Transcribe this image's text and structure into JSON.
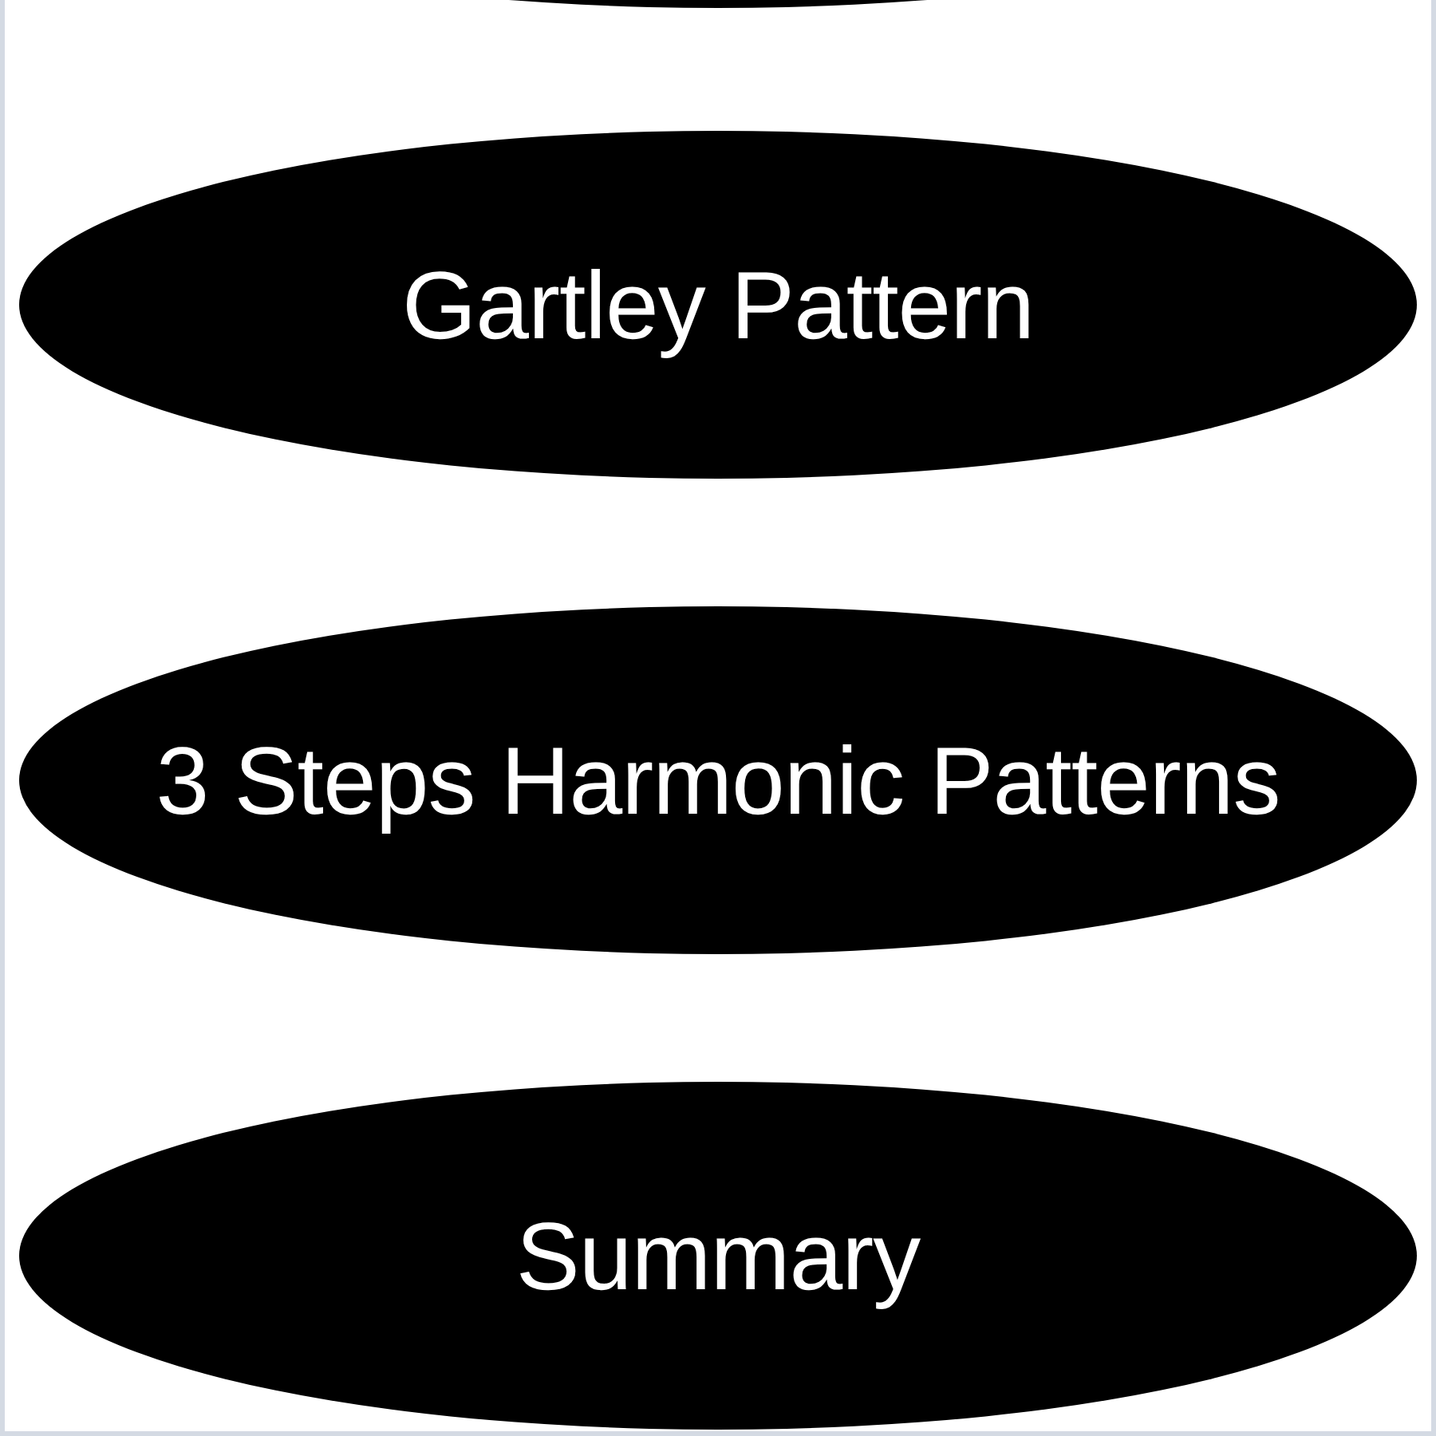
{
  "menu": {
    "buttons": [
      {
        "kind": "partial"
      },
      {
        "kind": "full",
        "label": "Gartley Pattern"
      },
      {
        "kind": "full",
        "label": "3 Steps Harmonic Patterns"
      },
      {
        "kind": "full",
        "label": "Summary"
      }
    ]
  }
}
